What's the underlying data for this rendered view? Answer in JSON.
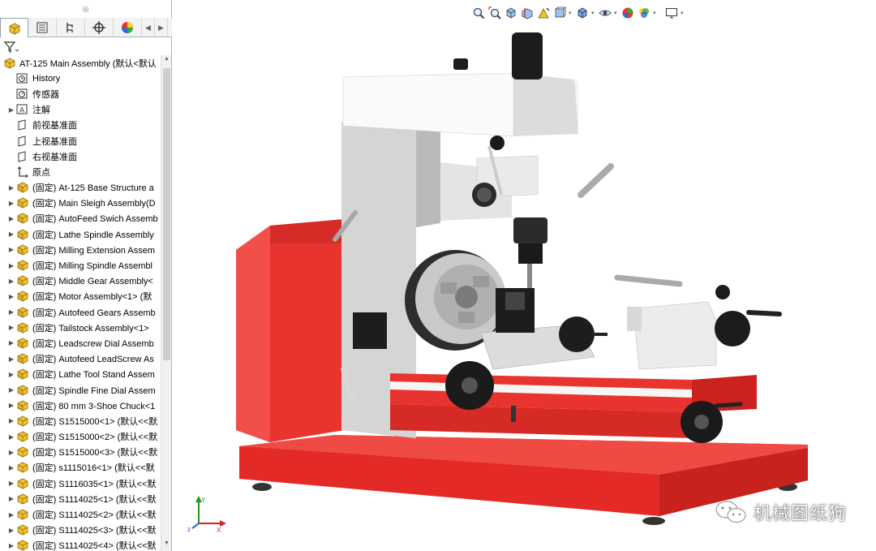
{
  "panel": {
    "tabs": [
      {
        "icon": "feature-manager-icon"
      },
      {
        "icon": "property-manager-icon"
      },
      {
        "icon": "configuration-manager-icon"
      },
      {
        "icon": "dimxpert-icon"
      },
      {
        "icon": "display-manager-icon"
      }
    ],
    "filter_icon": "filter-icon",
    "tree": {
      "root": "AT-125 Main Assembly  (默认<默认",
      "items": [
        {
          "label": "History",
          "icon": "history-icon",
          "expand": false
        },
        {
          "label": "传感器",
          "icon": "sensor-icon",
          "expand": false
        },
        {
          "label": "注解",
          "icon": "annotation-icon",
          "expand": true
        },
        {
          "label": "前视基准面",
          "icon": "plane-icon",
          "expand": false
        },
        {
          "label": "上视基准面",
          "icon": "plane-icon",
          "expand": false
        },
        {
          "label": "右视基准面",
          "icon": "plane-icon",
          "expand": false
        },
        {
          "label": "原点",
          "icon": "origin-icon",
          "expand": false
        },
        {
          "label": "(固定) At-125 Base Structure a",
          "icon": "assembly-icon",
          "expand": true
        },
        {
          "label": "(固定) Main Sleigh Assembly(D",
          "icon": "assembly-icon",
          "expand": true
        },
        {
          "label": "(固定) AutoFeed Swich Assemb",
          "icon": "assembly-icon",
          "expand": true
        },
        {
          "label": "(固定) Lathe Spindle Assembly",
          "icon": "assembly-icon",
          "expand": true
        },
        {
          "label": "(固定) Milling Extension Assem",
          "icon": "assembly-icon",
          "expand": true
        },
        {
          "label": "(固定) Milling Spindle Assembl",
          "icon": "assembly-icon",
          "expand": true
        },
        {
          "label": "(固定) Middle Gear Assembly<",
          "icon": "assembly-icon",
          "expand": true
        },
        {
          "label": "(固定) Motor Assembly<1> (默",
          "icon": "assembly-icon",
          "expand": true
        },
        {
          "label": "(固定) Autofeed Gears Assemb",
          "icon": "assembly-icon",
          "expand": true
        },
        {
          "label": "(固定) Tailstock Assembly<1>",
          "icon": "assembly-icon",
          "expand": true
        },
        {
          "label": "(固定) Leadscrew Dial Assemb",
          "icon": "assembly-icon",
          "expand": true
        },
        {
          "label": "(固定) Autofeed LeadScrew As",
          "icon": "assembly-icon",
          "expand": true
        },
        {
          "label": "(固定) Lathe Tool Stand Assem",
          "icon": "assembly-icon",
          "expand": true
        },
        {
          "label": "(固定) Spindle Fine Dial Assem",
          "icon": "assembly-icon",
          "expand": true
        },
        {
          "label": "(固定) 80 mm 3-Shoe Chuck<1",
          "icon": "assembly-icon",
          "expand": true
        },
        {
          "label": "(固定) S1515000<1> (默认<<默",
          "icon": "part-icon",
          "expand": true
        },
        {
          "label": "(固定) S1515000<2> (默认<<默",
          "icon": "part-icon",
          "expand": true
        },
        {
          "label": "(固定) S1515000<3> (默认<<默",
          "icon": "part-icon",
          "expand": true
        },
        {
          "label": "(固定) s1115016<1> (默认<<默",
          "icon": "part-icon",
          "expand": true
        },
        {
          "label": "(固定) S1116035<1> (默认<<默",
          "icon": "part-icon",
          "expand": true
        },
        {
          "label": "(固定) S1114025<1> (默认<<默",
          "icon": "part-icon",
          "expand": true
        },
        {
          "label": "(固定) S1114025<2> (默认<<默",
          "icon": "part-icon",
          "expand": true
        },
        {
          "label": "(固定) S1114025<3> (默认<<默",
          "icon": "part-icon",
          "expand": true
        },
        {
          "label": "(固定) S1114025<4> (默认<<默",
          "icon": "part-icon",
          "expand": true
        }
      ]
    }
  },
  "viewport": {
    "hud_icons": [
      "zoom-to-fit-icon",
      "zoom-to-area-icon",
      "previous-view-icon",
      "section-view-icon",
      "dynamic-annotation-icon",
      "view-orientation-icon",
      "display-style-icon",
      "hide-show-items-icon",
      "edit-appearance-icon",
      "apply-scene-icon",
      "view-settings-icon"
    ],
    "watermark": "机械图纸狗",
    "colors": {
      "red": "#e8332f",
      "grey": "#d9d9d9",
      "black": "#1a1a1a",
      "accent": "#2b6cb0"
    }
  }
}
